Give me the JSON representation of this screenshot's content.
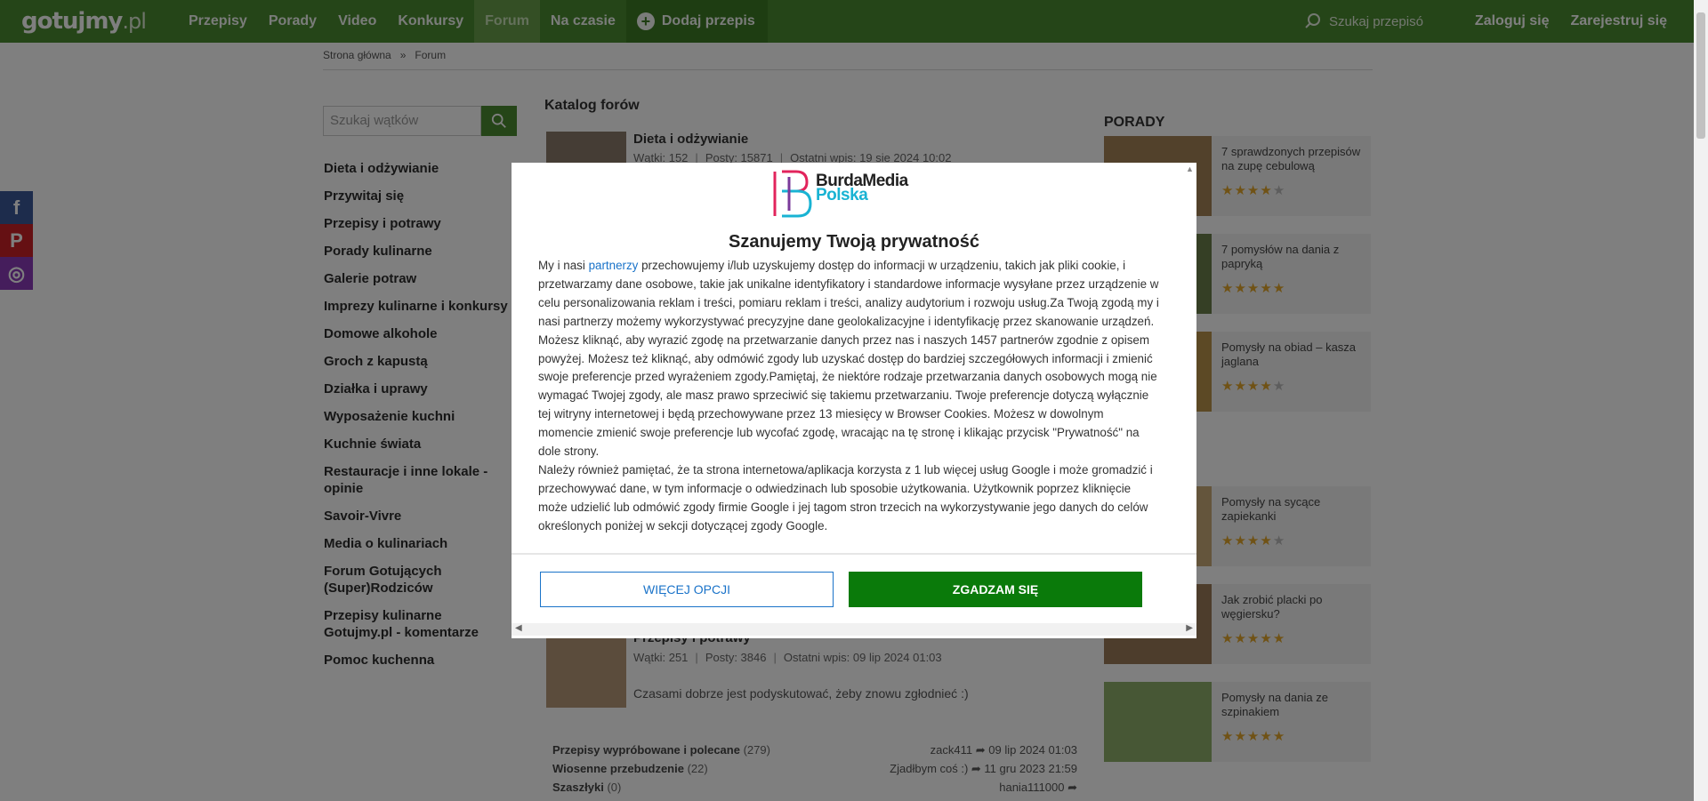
{
  "colors": {
    "nav_green": "#4a8a30",
    "agree_green": "#0a7a0a",
    "link_blue": "#1a73c9",
    "star": "#e0a52b"
  },
  "header": {
    "logo_main": "gotujmy",
    "logo_suffix": ".pl",
    "nav": [
      "Przepisy",
      "Porady",
      "Video",
      "Konkursy",
      "Forum",
      "Na czasie"
    ],
    "active_nav": "Forum",
    "add_recipe": "Dodaj przepis",
    "search_placeholder": "Szukaj przepisó",
    "login": "Zaloguj się",
    "register": "Zarejestruj się"
  },
  "breadcrumb": {
    "home": "Strona główna",
    "separator": "»",
    "current": "Forum"
  },
  "sidebar": {
    "search_placeholder": "Szukaj wątków",
    "forums": [
      "Dieta i odżywianie",
      "Przywitaj się",
      "Przepisy i potrawy",
      "Porady kulinarne",
      "Galerie potraw",
      "Imprezy kulinarne i konkursy",
      "Domowe alkohole",
      "Groch z kapustą",
      "Działka i uprawy",
      "Wyposażenie kuchni",
      "Kuchnie świata",
      "Restauracje i inne lokale - opinie",
      "Savoir-Vivre",
      "Media o kulinariach",
      "Forum Gotujących (Super)Rodziców",
      "Przepisy kulinarne Gotujmy.pl - komentarze",
      "Pomoc kuchenna"
    ]
  },
  "social": {
    "facebook": "f",
    "pinterest": "P",
    "instagram": "◎"
  },
  "main": {
    "catalog_title": "Katalog forów",
    "forums": [
      {
        "name": "Dieta i odżywianie",
        "meta": [
          "Wątki: 152",
          "Posty: 15871",
          "Ostatni wpis: 19 sie 2024 10:02"
        ]
      },
      {
        "name": "Przepisy i potrawy",
        "meta": [
          "Wątki: 251",
          "Posty: 3846",
          "Ostatni wpis: 09 lip 2024 01:03"
        ],
        "desc": "Czasami dobrze jest podyskutować, żeby znowu zgłodnieć :)"
      }
    ],
    "recent": [
      {
        "title": "Przepisy wypróbowane i polecane",
        "count": "(279)",
        "right": "zack411 ➦ 09 lip 2024 01:03"
      },
      {
        "title": "Wiosenne przebudzenie",
        "count": "(22)",
        "right": "Zjadłbym coś :) ➦ 11 gru 2023 21:59"
      },
      {
        "title": "Szaszłyki",
        "count": "(0)",
        "right": "hania111000 ➦"
      }
    ]
  },
  "right": {
    "title": "PORADY",
    "tips": [
      {
        "title": "7 sprawdzonych przepisów na zupę cebulową",
        "rating": 4
      },
      {
        "title": "7 pomysłów na dania z papryką",
        "rating": 5
      },
      {
        "title": "Pomysły na obiad – kasza jaglana",
        "rating": 4
      },
      {
        "title": "Pomysły na sycące zapiekanki",
        "rating": 4
      },
      {
        "title": "Jak zrobić placki po węgiersku?",
        "rating": 5
      },
      {
        "title": "Pomysły na dania ze szpinakiem",
        "rating": 5
      }
    ]
  },
  "consent": {
    "logo_line1": "BurdaMedia",
    "logo_line2": "Polska",
    "title": "Szanujemy Twoją prywatność",
    "body_intro": "My i nasi ",
    "body_link": "partnerzy",
    "body_rest": " przechowujemy i/lub uzyskujemy dostęp do informacji w urządzeniu, takich jak pliki cookie, i przetwarzamy dane osobowe, takie jak unikalne identyfikatory i standardowe informacje wysyłane przez urządzenie w celu personalizowania reklam i treści, pomiaru reklam i treści, analizy audytorium i rozwoju usług.Za Twoją zgodą my i nasi partnerzy możemy wykorzystywać precyzyjne dane geolokalizacyjne i identyfikację przez skanowanie urządzeń. Możesz kliknąć, aby wyrazić zgodę na przetwarzanie danych przez nas i naszych 1457 partnerów zgodnie z opisem powyżej. Możesz też kliknąć, aby odmówić zgody lub uzyskać dostęp do bardziej szczegółowych informacji i zmienić swoje preferencje przed wyrażeniem zgody.Pamiętaj, że niektóre rodzaje przetwarzania danych osobowych mogą nie wymagać Twojej zgody, ale masz prawo sprzeciwić się takiemu przetwarzaniu. Twoje preferencje dotyczą wyłącznie tej witryny internetowej i będą przechowywane przez 13 miesięcy w Browser Cookies. Możesz w dowolnym momencie zmienić swoje preferencje lub wycofać zgodę, wracając na tę stronę i klikając przycisk \"Prywatność\" na dole strony.",
    "body_google": "Należy również pamiętać, że ta strona internetowa/aplikacja korzysta z 1 lub więcej usług Google i może gromadzić i przechowywać dane, w tym informacje o odwiedzinach lub sposobie użytkowania. Użytkownik poprzez kliknięcie może udzielić lub odmówić zgody firmie Google i jej tagom stron trzecich na wykorzystywanie jego danych do celów określonych poniżej w sekcji dotyczącej zgody Google.",
    "more_options": "WIĘCEJ OPCJI",
    "agree": "ZGADZAM SIĘ"
  }
}
